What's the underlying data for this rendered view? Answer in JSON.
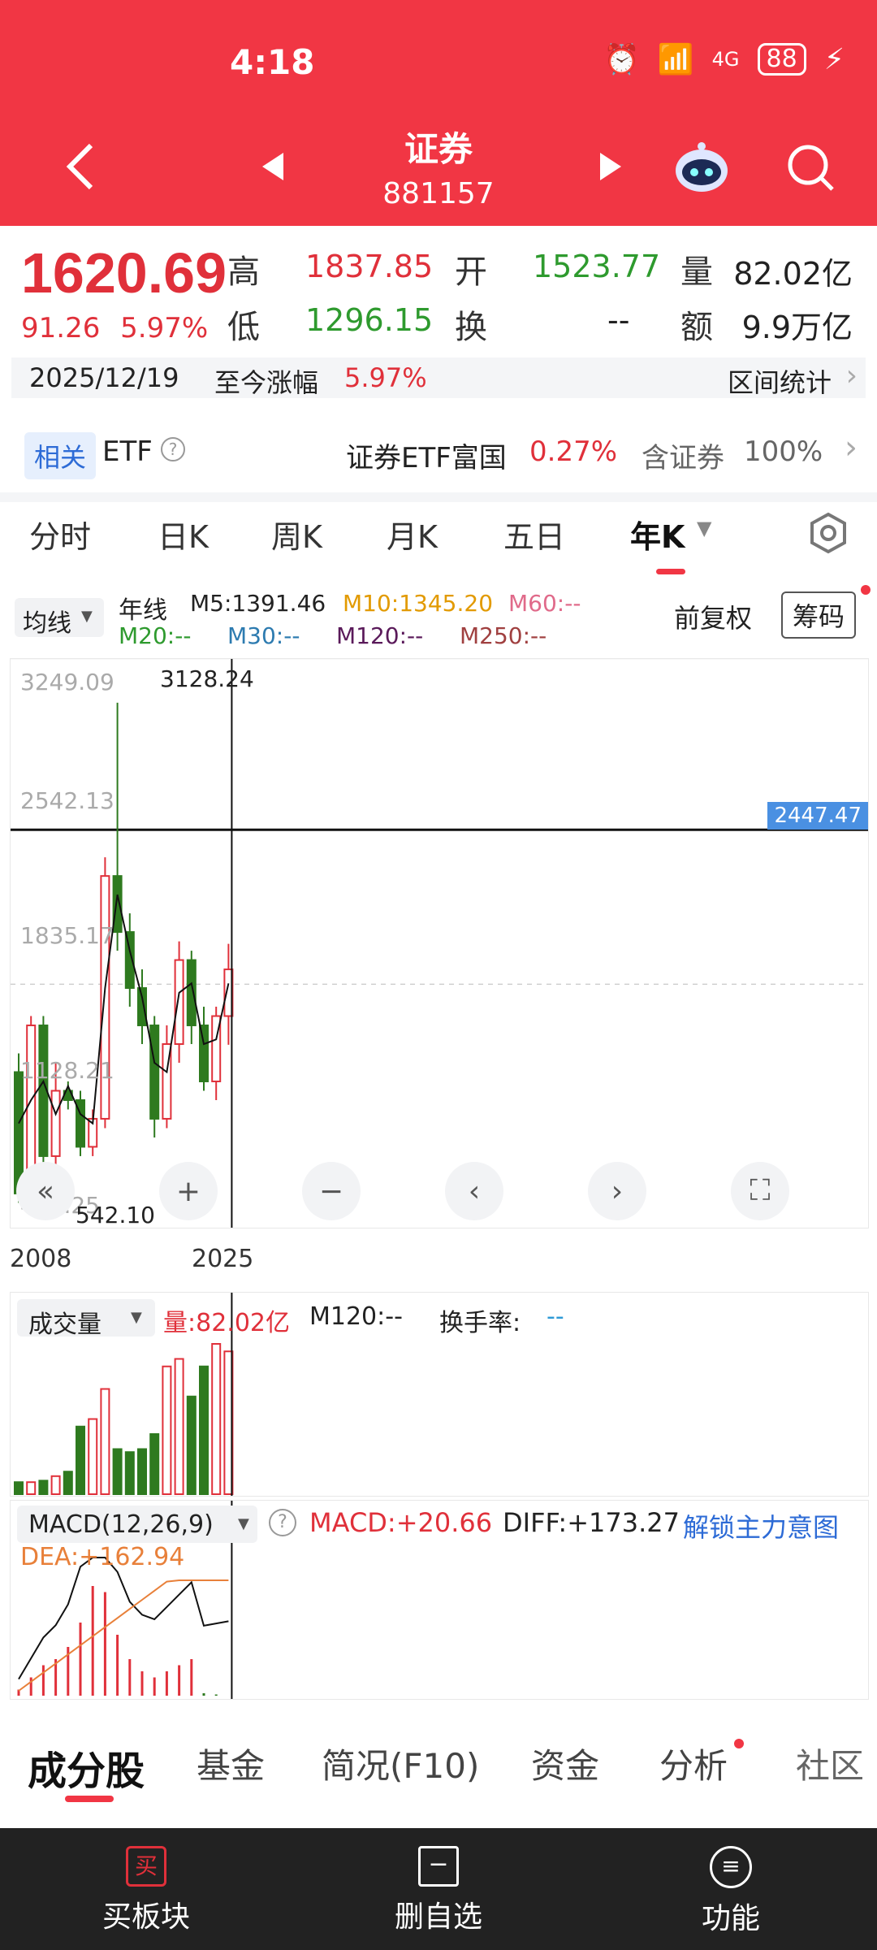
{
  "status": {
    "time": "4:18",
    "battery": "88",
    "net": "4G"
  },
  "header": {
    "title": "证券",
    "code": "881157"
  },
  "quote": {
    "price": "1620.69",
    "change": "91.26",
    "change_pct": "5.97%",
    "high_label": "高",
    "high": "1837.85",
    "low_label": "低",
    "low": "1296.15",
    "open_label": "开",
    "open": "1523.77",
    "turnover_label": "换",
    "turnover": "--",
    "volume_label": "量",
    "volume": "82.02亿",
    "amount_label": "额",
    "amount": "9.9万亿"
  },
  "date_row": {
    "date": "2025/12/19",
    "since_label": "至今涨幅",
    "since_value": "5.97%",
    "stats_label": "区间统计"
  },
  "etf_row": {
    "tag": "相关",
    "etf_label": "ETF",
    "etf_name": "证券ETF富国",
    "etf_change": "0.27%",
    "holding_label": "含证券",
    "holding_value": "100%"
  },
  "kline_tabs": [
    "分时",
    "日K",
    "周K",
    "月K",
    "五日",
    "年K"
  ],
  "indicators": {
    "ma_selector": "均线",
    "period": "年线",
    "m5": "M5:1391.46",
    "m10": "M10:1345.20",
    "m60": "M60:--",
    "m20": "M20:--",
    "m30": "M30:--",
    "m120": "M120:--",
    "m250": "M250:--",
    "adjust": "前复权",
    "chips": "筹码"
  },
  "chart_data": {
    "type": "candlestick",
    "x_range": [
      "2008",
      "2025"
    ],
    "y_ticks": [
      "3249.09",
      "2542.13",
      "1835.17",
      "1128.21",
      "421.25"
    ],
    "high_marker": "3128.24",
    "low_marker": "542.10",
    "crosshair_value": "2447.47",
    "candles": [
      {
        "o": 1150,
        "c": 500,
        "h": 1250,
        "l": 450
      },
      {
        "o": 500,
        "c": 1400,
        "h": 1450,
        "l": 470
      },
      {
        "o": 1400,
        "c": 700,
        "h": 1450,
        "l": 650
      },
      {
        "o": 700,
        "c": 1050,
        "h": 1200,
        "l": 650
      },
      {
        "o": 1050,
        "c": 1000,
        "h": 1100,
        "l": 950
      },
      {
        "o": 1000,
        "c": 750,
        "h": 1050,
        "l": 700
      },
      {
        "o": 750,
        "c": 900,
        "h": 950,
        "l": 700
      },
      {
        "o": 900,
        "c": 2200,
        "h": 2300,
        "l": 850
      },
      {
        "o": 2200,
        "c": 1900,
        "h": 3128,
        "l": 1800
      },
      {
        "o": 1900,
        "c": 1600,
        "h": 2000,
        "l": 1500
      },
      {
        "o": 1600,
        "c": 1400,
        "h": 1700,
        "l": 1300
      },
      {
        "o": 1400,
        "c": 900,
        "h": 1450,
        "l": 800
      },
      {
        "o": 900,
        "c": 1300,
        "h": 1400,
        "l": 850
      },
      {
        "o": 1300,
        "c": 1750,
        "h": 1850,
        "l": 1200
      },
      {
        "o": 1750,
        "c": 1400,
        "h": 1800,
        "l": 1300
      },
      {
        "o": 1400,
        "c": 1100,
        "h": 1500,
        "l": 1050
      },
      {
        "o": 1100,
        "c": 1450,
        "h": 1500,
        "l": 1000
      },
      {
        "o": 1450,
        "c": 1700,
        "h": 1837,
        "l": 1296
      }
    ],
    "volume": [
      0.08,
      0.08,
      0.09,
      0.12,
      0.15,
      0.45,
      0.5,
      0.7,
      0.3,
      0.28,
      0.3,
      0.4,
      0.85,
      0.9,
      0.65,
      0.85,
      1.0,
      0.95
    ],
    "macd_hist": [
      0.05,
      0.15,
      0.25,
      0.3,
      0.4,
      0.6,
      0.9,
      0.85,
      0.5,
      0.3,
      0.2,
      0.15,
      0.2,
      0.25,
      0.3,
      0.02,
      0.01,
      0.0
    ]
  },
  "volume_panel": {
    "selector": "成交量",
    "value": "量:82.02亿",
    "m120": "M120:--",
    "turnover": "换手率:",
    "turnover_value": "--"
  },
  "macd_panel": {
    "selector": "MACD(12,26,9)",
    "macd": "MACD:+20.66",
    "diff": "DIFF:+173.27",
    "unlock": "解锁主力意图",
    "dea": "DEA:+162.94"
  },
  "bottom_tabs": [
    "成分股",
    "基金",
    "简况(F10)",
    "资金",
    "分析",
    "社区"
  ],
  "nav": {
    "buy": "买板块",
    "buy_icon": "买",
    "remove": "删自选",
    "more": "功能"
  },
  "colors": {
    "up": "#e0303a",
    "down": "#2e7a1f",
    "accent": "#f13644",
    "blue": "#2d6bd6"
  }
}
